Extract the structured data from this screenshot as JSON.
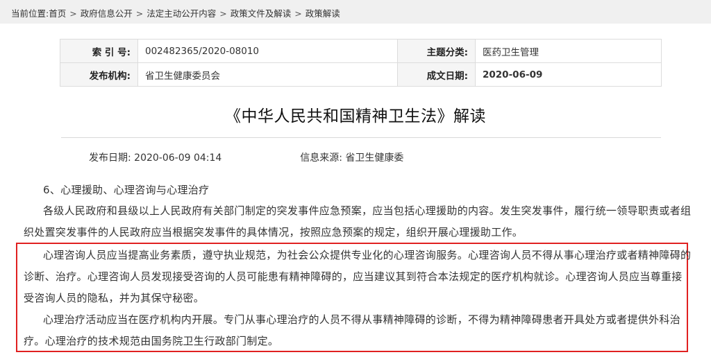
{
  "breadcrumb": {
    "prefix": "当前位置:",
    "items": [
      "首页",
      "政府信息公开",
      "法定主动公开内容",
      "政策文件及解读",
      "政策解读"
    ],
    "separator": ">"
  },
  "meta": {
    "index_label": "索 引 号:",
    "index_value": "002482365/2020-08010",
    "category_label": "主题分类:",
    "category_value": "医药卫生管理",
    "publisher_label": "发布机构:",
    "publisher_value": "省卫生健康委员会",
    "date_label": "成文日期:",
    "date_value": "2020-06-09"
  },
  "article": {
    "title": "《中华人民共和国精神卫生法》解读",
    "publish_date_label": "发布日期:",
    "publish_date": "2020-06-09 04:14",
    "source_label": "信息来源:",
    "source": "省卫生健康委",
    "section_heading": "6、心理援助、心理咨询与心理治疗",
    "paragraphs": [
      "各级人民政府和县级以上人民政府有关部门制定的突发事件应急预案，应当包括心理援助的内容。发生突发事件，履行统一领导职责或者组织处置突发事件的人民政府应当根据突发事件的具体情况，按照应急预案的规定，组织开展心理援助工作。",
      "心理咨询人员应当提高业务素质，遵守执业规范，为社会公众提供专业化的心理咨询服务。心理咨询人员不得从事心理治疗或者精神障碍的诊断、治疗。心理咨询人员发现接受咨询的人员可能患有精神障碍的，应当建议其到符合本法规定的医疗机构就诊。心理咨询人员应当尊重接受咨询人员的隐私，并为其保守秘密。",
      "心理治疗活动应当在医疗机构内开展。专门从事心理治疗的人员不得从事精神障碍的诊断，不得为精神障碍患者开具处方或者提供外科治疗。心理治疗的技术规范由国务院卫生行政部门制定。"
    ]
  },
  "colors": {
    "highlight_border": "#e02020",
    "breadcrumb_bg": "#f0f0f0",
    "label_bg": "#f5f5f5"
  }
}
